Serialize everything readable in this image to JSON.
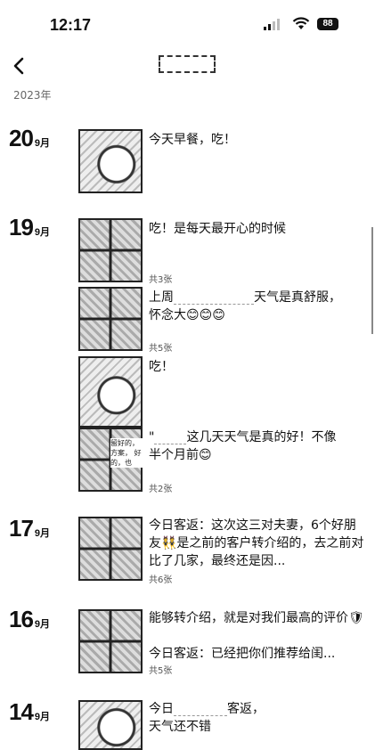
{
  "status": {
    "time": "12:17",
    "battery": "88"
  },
  "nav": {
    "title": ""
  },
  "year": "2023年",
  "entries": [
    {
      "day": "20",
      "month": "9月",
      "posts": [
        {
          "text": "今天早餐，吃！",
          "count": ""
        }
      ]
    },
    {
      "day": "19",
      "month": "9月",
      "posts": [
        {
          "text": "吃！是每天最开心的时候",
          "count": "共3张"
        },
        {
          "text_a": "上周",
          "text_b": "天气是真舒服，\n怀念大😊😊😊",
          "count": "共5张"
        },
        {
          "text": "吃！",
          "count": ""
        },
        {
          "text_a": "\"",
          "text_b": "这几天天气是真的好！不像\n半个月前😊",
          "count": "共2张",
          "side_note": "留好的，\n方案，\n好的，也"
        }
      ]
    },
    {
      "day": "17",
      "month": "9月",
      "posts": [
        {
          "text": "今日客返：这次这三对夫妻，6个好朋友👯是之前的客户转介绍的，去之前对比了几家，最终还是因...",
          "count": "共6张"
        }
      ]
    },
    {
      "day": "16",
      "month": "9月",
      "posts": [
        {
          "text": "能够转介绍，就是对我们最高的评价🛡",
          "count": ""
        },
        {
          "text": "今日客返：已经把你们推荐给闺...",
          "count": "共5张"
        }
      ]
    },
    {
      "day": "14",
      "month": "9月",
      "posts": [
        {
          "text_a": "今日",
          "text_b": "客返，\n天气还不错",
          "count": ""
        }
      ]
    }
  ]
}
